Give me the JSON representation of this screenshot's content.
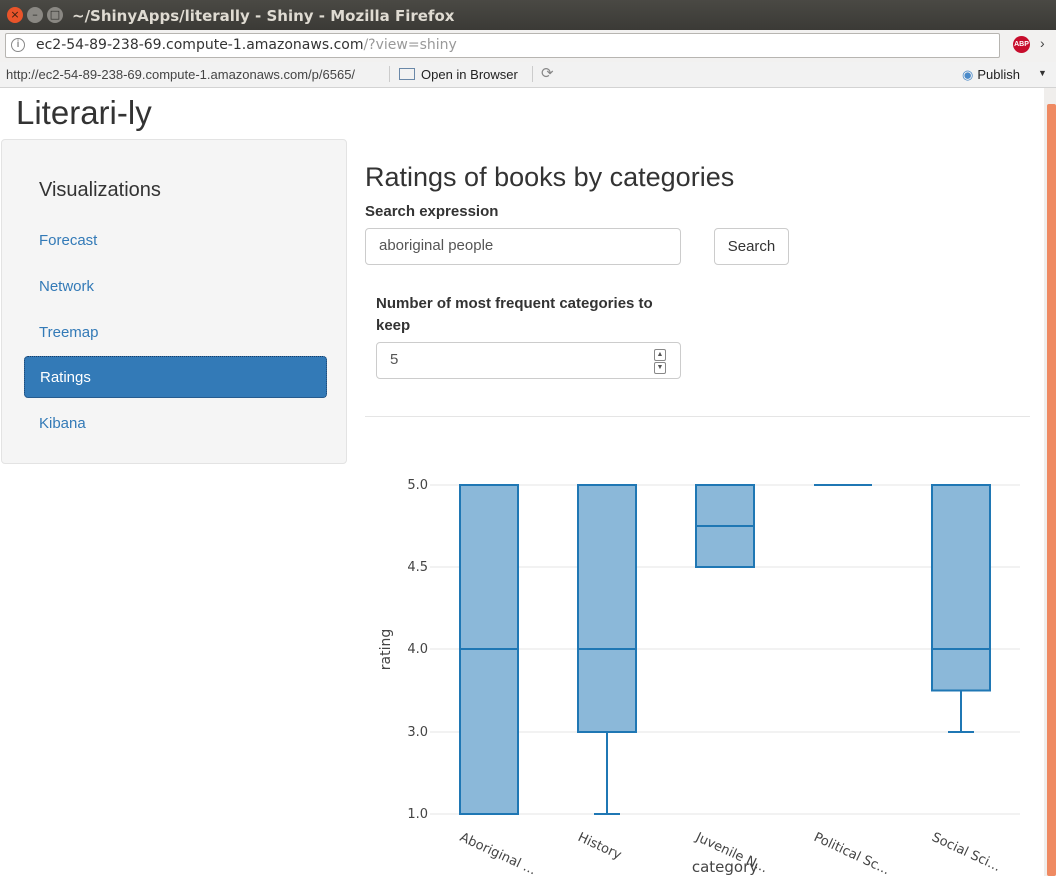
{
  "browser": {
    "window_title": "~/ShinyApps/literally - Shiny - Mozilla Firefox",
    "url_host": "ec2-54-89-238-69.compute-1.amazonaws.com",
    "url_path": "/?view=shiny",
    "close_glyph": "×",
    "minimize_glyph": "–",
    "maximize_glyph": "□"
  },
  "rstudio_bar": {
    "viewer_url": "http://ec2-54-89-238-69.compute-1.amazonaws.com/p/6565/",
    "open_in_browser_label": "Open in Browser",
    "publish_label": "Publish",
    "abp_label": "ABP"
  },
  "app": {
    "title": "Literari-ly",
    "sidebar": {
      "heading": "Visualizations",
      "items": [
        {
          "label": "Forecast",
          "active": false
        },
        {
          "label": "Network",
          "active": false
        },
        {
          "label": "Treemap",
          "active": false
        },
        {
          "label": "Ratings",
          "active": true
        },
        {
          "label": "Kibana",
          "active": false
        }
      ]
    },
    "main": {
      "title": "Ratings of books by categories",
      "search_label": "Search expression",
      "search_value": "aboriginal people",
      "search_button_label": "Search",
      "num_label_line1": "Number of most frequent categories to",
      "num_label_line2": "keep",
      "num_value": "5"
    }
  },
  "chart_data": {
    "type": "box",
    "xlabel": "category",
    "ylabel": "rating",
    "y_ticks": [
      "5.0",
      "4.5",
      "4.0",
      "3.0",
      "1.0"
    ],
    "categories": [
      "Aboriginal ...",
      "History",
      "Juvenile N...",
      "Political Sc...",
      "Social Sci..."
    ],
    "boxes": [
      {
        "min": 1.0,
        "q1": 1.0,
        "median": 4.0,
        "q3": 5.0,
        "max": 5.0
      },
      {
        "min": 1.0,
        "q1": 3.0,
        "median": 4.0,
        "q3": 5.0,
        "max": 5.0
      },
      {
        "min": 4.5,
        "q1": 4.5,
        "median": 4.75,
        "q3": 5.0,
        "max": 5.0
      },
      {
        "min": 5.0,
        "q1": 5.0,
        "median": 5.0,
        "q3": 5.0,
        "max": 5.0
      },
      {
        "min": 3.0,
        "q1": 3.5,
        "median": 4.0,
        "q3": 5.0,
        "max": 5.0
      }
    ],
    "box_fill": "#8bb8d9",
    "box_stroke": "#1f77b4",
    "grid": true
  }
}
